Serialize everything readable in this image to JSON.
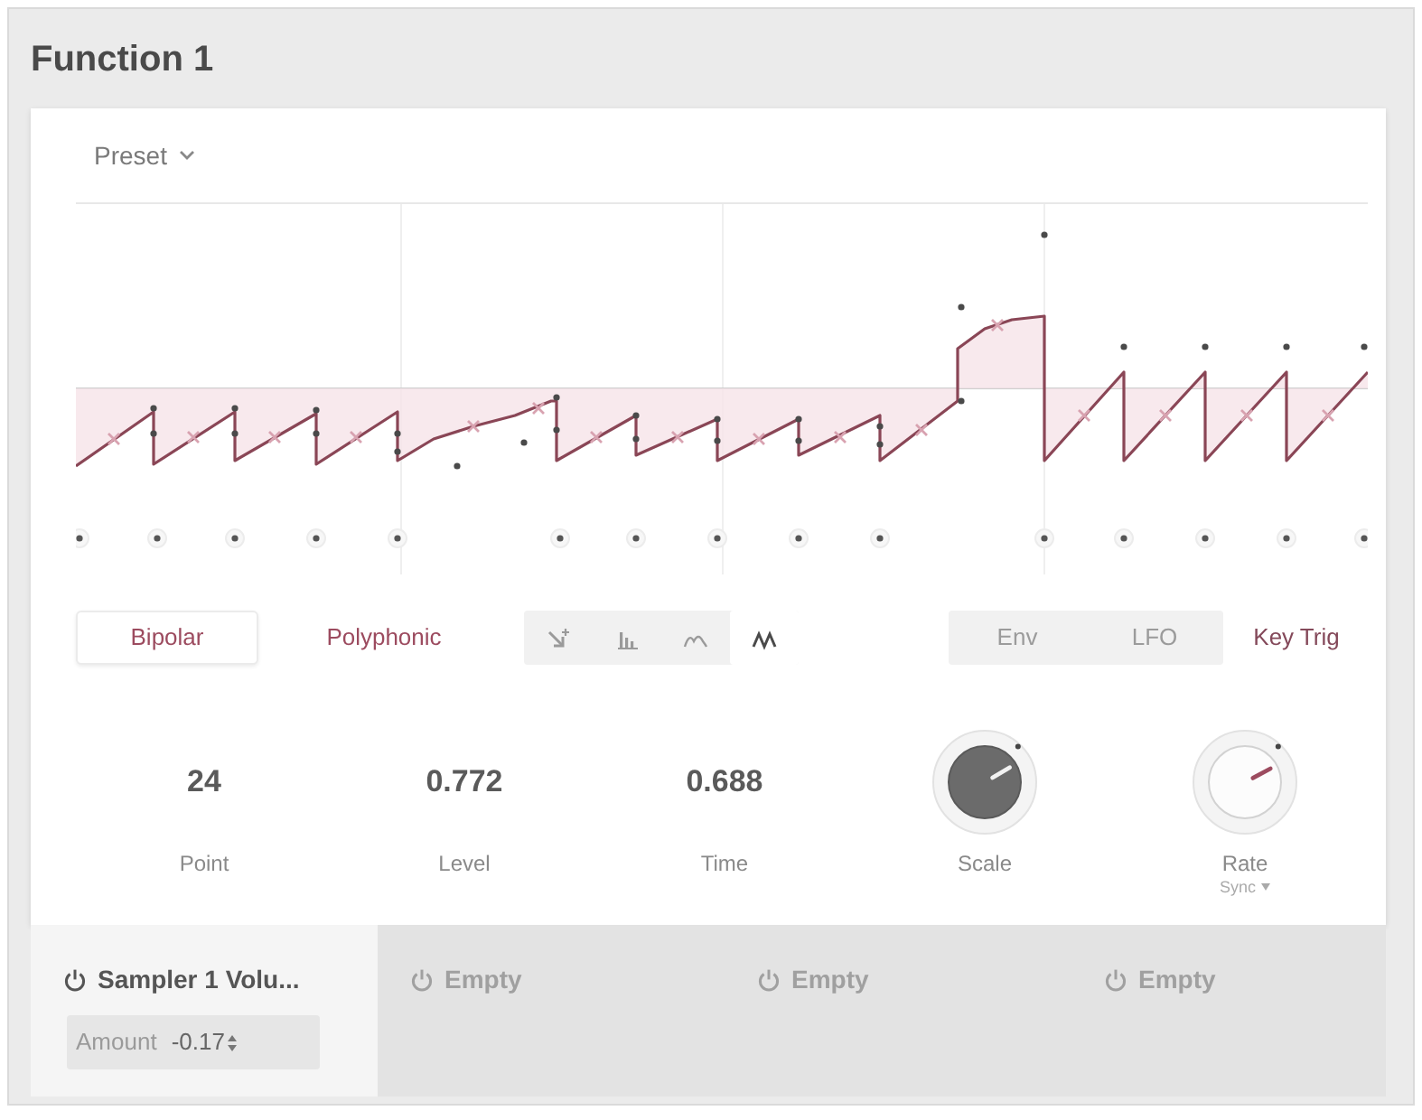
{
  "panel": {
    "title": "Function 1"
  },
  "preset": {
    "label": "Preset"
  },
  "toggles": [
    {
      "label": "Bipolar",
      "on": true
    },
    {
      "label": "Polyphonic",
      "on": false
    }
  ],
  "tools": [
    {
      "kind": "pointer",
      "selected": false
    },
    {
      "kind": "bars",
      "selected": false
    },
    {
      "kind": "curve",
      "selected": false
    },
    {
      "kind": "zigzag",
      "selected": true
    }
  ],
  "modes": [
    {
      "label": "Env",
      "disabled": true
    },
    {
      "label": "LFO",
      "disabled": true
    }
  ],
  "key_trig": {
    "label": "Key Trig",
    "on": false
  },
  "parameters": [
    {
      "kind": "value",
      "value": "24",
      "label": "Point"
    },
    {
      "kind": "value",
      "value": "0.772",
      "label": "Level"
    },
    {
      "kind": "value",
      "value": "0.688",
      "label": "Time"
    },
    {
      "kind": "knob",
      "label": "Scale",
      "filled": true,
      "level": 0.72
    },
    {
      "kind": "knob",
      "label": "Rate",
      "filled": false,
      "level": 0.73,
      "option": "Sync"
    }
  ],
  "slots": [
    {
      "title": "Sampler 1 Volu...",
      "assigned": true,
      "selected": true,
      "amount": {
        "label": "Amount",
        "value": "-0.17"
      }
    },
    {
      "title": "Empty",
      "assigned": false,
      "selected": false
    },
    {
      "title": "Empty",
      "assigned": false,
      "selected": false
    },
    {
      "title": "Empty",
      "assigned": false,
      "selected": false
    }
  ]
}
